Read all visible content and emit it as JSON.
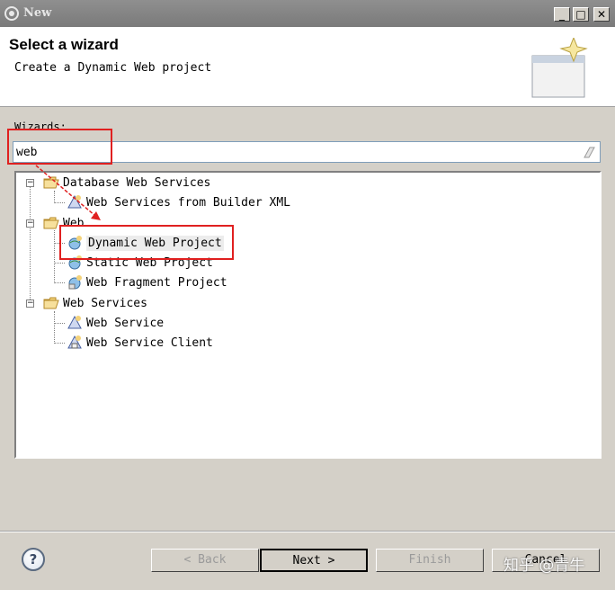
{
  "window": {
    "title": "New",
    "min_label": "_",
    "max_label": "□",
    "close_label": "✕"
  },
  "header": {
    "title": "Select a wizard",
    "description": "Create a Dynamic Web project"
  },
  "wizards_label": "Wizards:",
  "filter": {
    "value": "web"
  },
  "tree": {
    "groups": [
      {
        "label": "Database Web Services",
        "expanded": true,
        "toggle": "−",
        "items": [
          {
            "label": "Web Services from Builder XML",
            "icon": "web-service-icon"
          }
        ]
      },
      {
        "label": "Web",
        "expanded": true,
        "toggle": "−",
        "items": [
          {
            "label": "Dynamic Web Project",
            "icon": "globe-project-icon",
            "selected": true
          },
          {
            "label": "Static Web Project",
            "icon": "globe-project-icon"
          },
          {
            "label": "Web Fragment Project",
            "icon": "globe-fragment-icon"
          }
        ]
      },
      {
        "label": "Web Services",
        "expanded": true,
        "toggle": "−",
        "items": [
          {
            "label": "Web Service",
            "icon": "web-service-icon"
          },
          {
            "label": "Web Service Client",
            "icon": "web-service-client-icon"
          }
        ]
      }
    ]
  },
  "buttons": {
    "help": "?",
    "back": "< Back",
    "next": "Next >",
    "finish": "Finish",
    "cancel": "Cancel"
  },
  "watermark": "知乎 @青牛",
  "colors": {
    "highlight": "#e02020",
    "titlebar": "#7a7a7a",
    "dialog": "#d4d0c8"
  }
}
